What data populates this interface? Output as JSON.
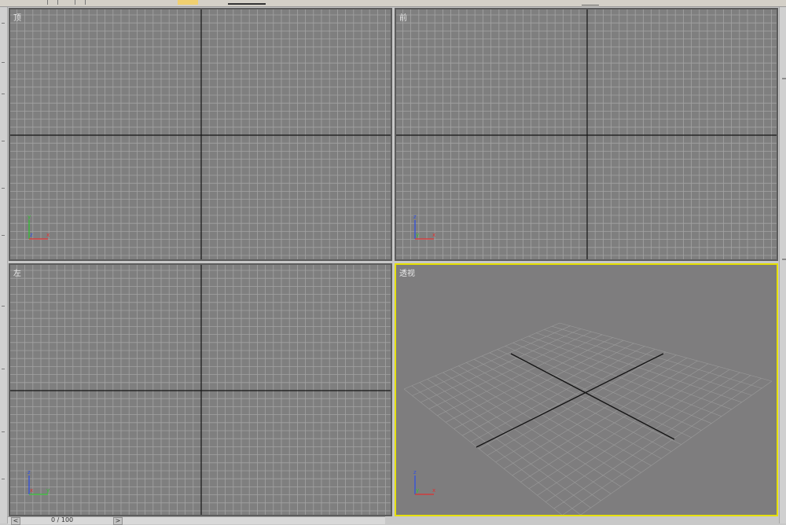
{
  "viewports": [
    {
      "id": "top",
      "label": "顶",
      "axes": {
        "up": "y",
        "right": "x",
        "origin": "z"
      },
      "active": false
    },
    {
      "id": "front",
      "label": "前",
      "axes": {
        "up": "z",
        "right": "x",
        "origin": "y"
      },
      "active": false
    },
    {
      "id": "left",
      "label": "左",
      "axes": {
        "up": "z",
        "right": "y",
        "origin": "x"
      },
      "active": false
    },
    {
      "id": "perspective",
      "label": "透视",
      "axes": {
        "up": "z",
        "right": "x",
        "origin": "y"
      },
      "active": true
    }
  ],
  "time_slider": {
    "position_text": "0 / 100",
    "prev_label": "<",
    "next_label": ">"
  },
  "colors": {
    "grid_bg": "#7f7f7f",
    "grid_line": "#a3a3a3",
    "major_axis": "#151515",
    "active_border": "#e6e000",
    "axis_x": "#e03030",
    "axis_y": "#30c030",
    "axis_z": "#3050e0"
  }
}
